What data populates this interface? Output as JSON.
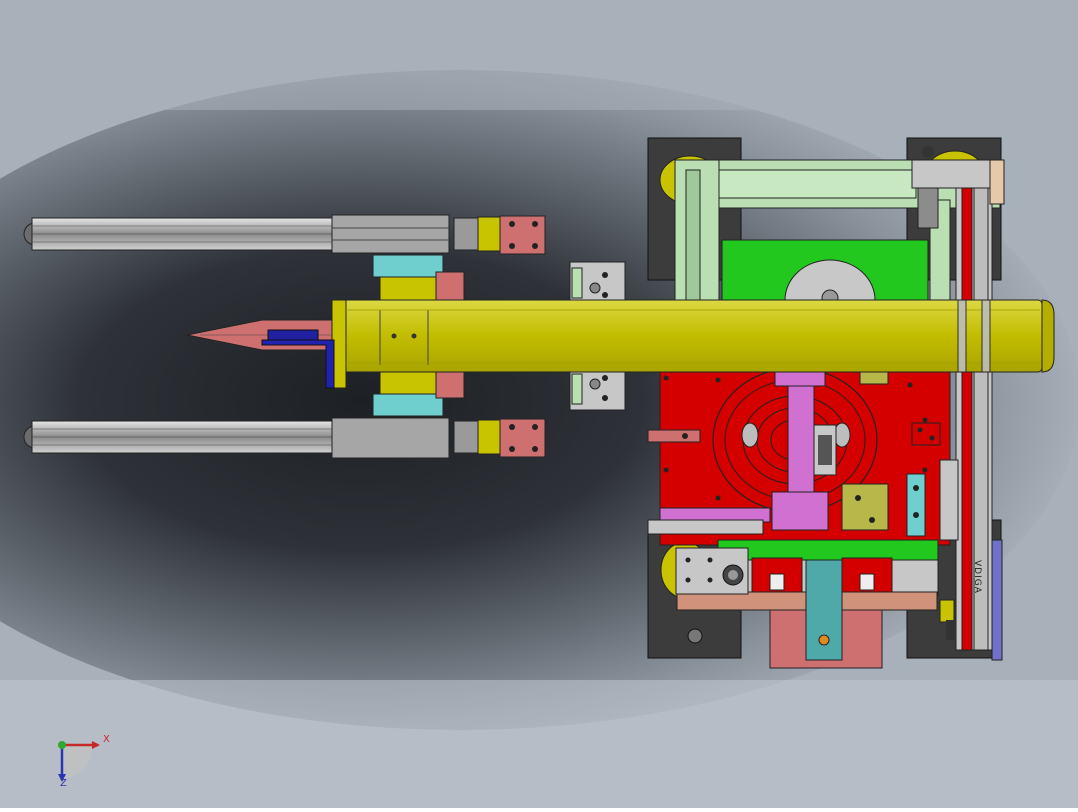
{
  "viewport": {
    "background_top": "#a9b0ba",
    "background_center": "#2e3238",
    "background_bottom": "#bfc6cf"
  },
  "model": {
    "brand_label": "VDIGA",
    "colors": {
      "yellow": "#c9c402",
      "red": "#d40000",
      "green": "#22c81e",
      "light_green": "#b9dfb3",
      "dark": "#3a3a3a",
      "gray": "#a7a7a7",
      "pink": "#cf7070",
      "cyan": "#6fcfcf",
      "magenta": "#d070d0",
      "blue": "#2020a0",
      "salmon": "#e88a8a",
      "olive": "#b7b74a",
      "teal": "#4fa9a9"
    }
  },
  "triad": {
    "x_label": "X",
    "z_label": "Z"
  }
}
